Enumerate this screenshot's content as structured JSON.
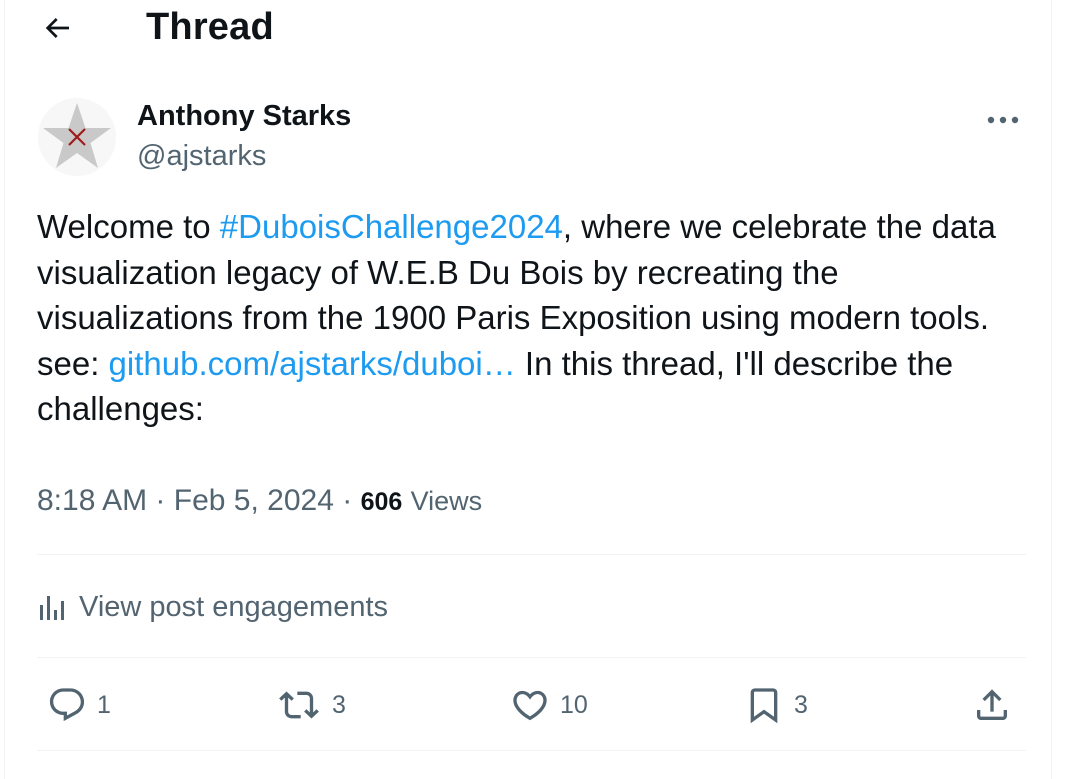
{
  "header": {
    "title": "Thread",
    "back_icon": "back-arrow-icon"
  },
  "author": {
    "name": "Anthony Starks",
    "handle": "@ajstarks",
    "avatar_icon": "star-avatar-icon"
  },
  "post": {
    "text_before_hashtag": "Welcome to ",
    "hashtag": "#DuboisChallenge2024",
    "text_after_hashtag": ", where we celebrate the data visualization legacy of W.E.B Du Bois by recreating the visualizations from the 1900 Paris Exposition using modern tools.  see: ",
    "link": "github.com/ajstarks/duboi…",
    "text_after_link": "  In this thread, I'll describe the challenges:"
  },
  "meta": {
    "time": "8:18 AM",
    "separator": "·",
    "date": "Feb 5, 2024",
    "views_count": "606",
    "views_label": "Views"
  },
  "engagements": {
    "label": "View post engagements",
    "icon": "analytics-bars-icon"
  },
  "actions": {
    "reply": {
      "count": "1",
      "icon": "reply-icon"
    },
    "repost": {
      "count": "3",
      "icon": "repost-icon"
    },
    "like": {
      "count": "10",
      "icon": "heart-icon"
    },
    "bookmark": {
      "count": "3",
      "icon": "bookmark-icon"
    },
    "share": {
      "icon": "share-icon"
    }
  },
  "colors": {
    "text": "#0f1419",
    "secondary": "#536471",
    "link": "#1d9bf0",
    "divider": "#eff3f4"
  }
}
